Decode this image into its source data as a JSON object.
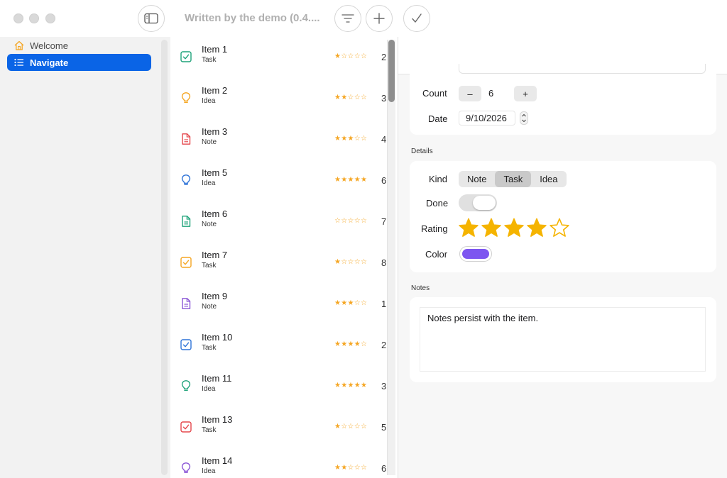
{
  "window": {
    "title": "Written by the demo (0.4....",
    "toolbar": {
      "sidebar_toggle_icon": "sidebar-icon",
      "filter_icon": "filter-icon",
      "add_icon": "plus-icon",
      "confirm_icon": "checkmark-icon"
    }
  },
  "sidebar": {
    "items": [
      {
        "label": "Welcome",
        "icon": "house-icon",
        "selected": false
      },
      {
        "label": "Navigate",
        "icon": "list-icon",
        "selected": true
      }
    ]
  },
  "list": {
    "rows": [
      {
        "title": "Item 1",
        "kind": "Task",
        "rating": 1,
        "count": "2",
        "icon": "checkbox-icon",
        "color": "#1fa37a"
      },
      {
        "title": "Item 2",
        "kind": "Idea",
        "rating": 2,
        "count": "3",
        "icon": "lightbulb-icon",
        "color": "#f5a623"
      },
      {
        "title": "Item 3",
        "kind": "Note",
        "rating": 3,
        "count": "4",
        "icon": "document-icon",
        "color": "#e5484d"
      },
      {
        "title": "Item 5",
        "kind": "Idea",
        "rating": 5,
        "count": "6",
        "icon": "lightbulb-icon",
        "color": "#2f74d8"
      },
      {
        "title": "Item 6",
        "kind": "Note",
        "rating": 0,
        "count": "7",
        "icon": "document-icon",
        "color": "#1fa37a"
      },
      {
        "title": "Item 7",
        "kind": "Task",
        "rating": 1,
        "count": "8",
        "icon": "checkbox-icon",
        "color": "#f5a623"
      },
      {
        "title": "Item 9",
        "kind": "Note",
        "rating": 3,
        "count": "1",
        "icon": "document-icon",
        "color": "#8a55d6"
      },
      {
        "title": "Item 10",
        "kind": "Task",
        "rating": 4,
        "count": "2",
        "icon": "checkbox-icon",
        "color": "#2f74d8"
      },
      {
        "title": "Item 11",
        "kind": "Idea",
        "rating": 5,
        "count": "3",
        "icon": "lightbulb-icon",
        "color": "#1fa37a"
      },
      {
        "title": "Item 13",
        "kind": "Task",
        "rating": 1,
        "count": "5",
        "icon": "checkbox-icon",
        "color": "#e5484d"
      },
      {
        "title": "Item 14",
        "kind": "Idea",
        "rating": 2,
        "count": "6",
        "icon": "lightbulb-icon",
        "color": "#8a55d6"
      }
    ]
  },
  "detail": {
    "count_label": "Count",
    "count_value": "6",
    "decrement_label": "–",
    "increment_label": "+",
    "date_label": "Date",
    "date_value": "9/10/2026",
    "details_section": "Details",
    "kind_label": "Kind",
    "kind_options": [
      "Note",
      "Task",
      "Idea"
    ],
    "kind_selected": "Task",
    "done_label": "Done",
    "done_value": false,
    "rating_label": "Rating",
    "rating_value": 4,
    "rating_max": 5,
    "color_label": "Color",
    "color_value": "#7d55f0",
    "notes_section": "Notes",
    "notes_text": "Notes persist with the item."
  },
  "colors": {
    "accent": "#0a64e6",
    "star": "#f5b400"
  }
}
